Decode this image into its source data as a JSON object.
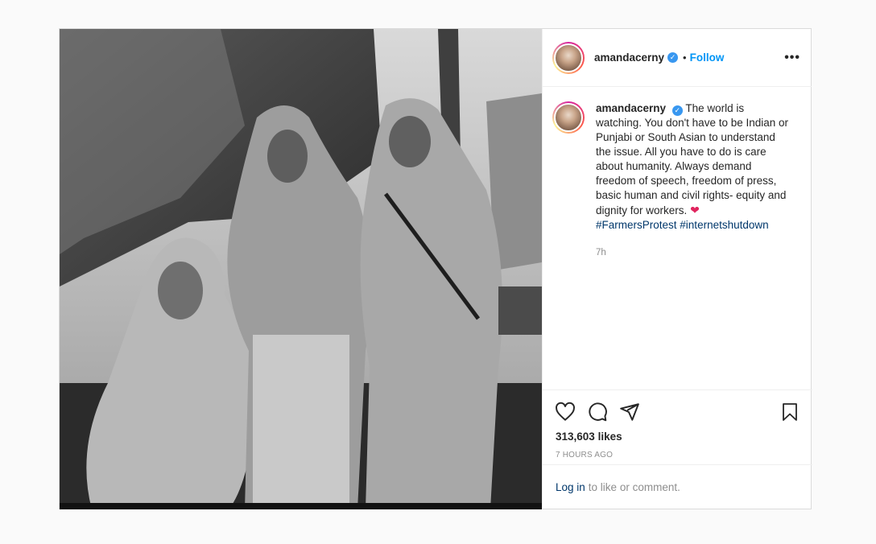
{
  "post": {
    "media": {
      "description_icon": "photo"
    },
    "header": {
      "username": "amandacerny",
      "separator": "•",
      "follow_label": "Follow",
      "more_icon": "more-icon",
      "more_glyph": "•••"
    },
    "caption": {
      "username": "amandacerny",
      "text": "The world is watching. You don't have to be Indian or Punjabi or South Asian to understand the issue. All you have to do is care about humanity. Always demand freedom of speech, freedom of press, basic human and civil rights- equity and dignity for workers.",
      "emoji": "❤",
      "hashtag_1": "#FarmersProtest",
      "hashtag_2": "#internetshutdown",
      "age": "7h"
    },
    "actions": {
      "likes_count": "313,603",
      "likes_label": "likes",
      "timestamp": "7 HOURS AGO",
      "login_link": "Log in",
      "login_text": "to like or comment."
    },
    "colors": {
      "follow": "#0095f6",
      "hashtag": "#00376b",
      "verified": "#3897f0",
      "muted": "#8e8e8e",
      "border": "#dbdbdb"
    }
  }
}
